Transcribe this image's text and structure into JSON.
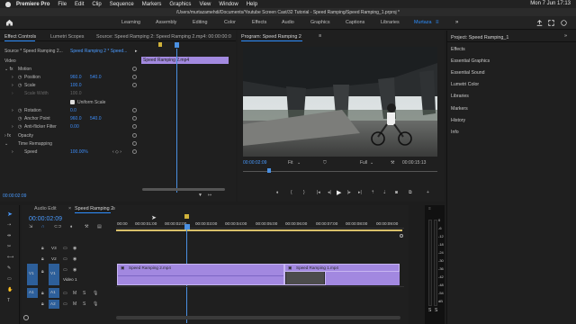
{
  "mac_menu": {
    "app": "Premiere Pro",
    "items": [
      "File",
      "Edit",
      "Clip",
      "Sequence",
      "Markers",
      "Graphics",
      "View",
      "Window",
      "Help"
    ],
    "clock": "Mon 7 Jun  17:13"
  },
  "window_title": "/Users/murtazamehdi/Documents/Youtube Screen Cast/32 Tutorial - Speed Ramping/Speed Ramping_1.prproj *",
  "workspaces": [
    "Learning",
    "Assembly",
    "Editing",
    "Color",
    "Effects",
    "Audio",
    "Graphics",
    "Captions",
    "Libraries",
    "Murtaza"
  ],
  "active_workspace": "Murtaza",
  "effect_controls": {
    "tabs": [
      "Effect Controls",
      "Lumetri Scopes",
      "Source: Speed Ramping 2: Speed Ramping 2.mp4: 00:00:00:00"
    ],
    "source": "Source * Speed Ramping 2...",
    "clip": "Speed Ramping 2 * Speed...",
    "clip_bar_label": "Speed Ramping 2.mp4",
    "video_header": "Video",
    "motion": {
      "label": "Motion",
      "position_label": "Position",
      "position_x": "960.0",
      "position_y": "540.0",
      "scale_label": "Scale",
      "scale_val": "100.0",
      "scale_width_label": "Scale Width",
      "scale_width_val": "100.0",
      "uniform_scale": "Uniform Scale",
      "rotation_label": "Rotation",
      "rotation_val": "0.0",
      "anchor_label": "Anchor Point",
      "anchor_x": "960.0",
      "anchor_y": "540.0",
      "anti_flicker_label": "Anti-flicker Filter",
      "anti_flicker_val": "0.00"
    },
    "opacity": "Opacity",
    "time_remapping": "Time Remapping",
    "speed_label": "Speed",
    "speed_val": "100.00%",
    "timecode": "00:00:02:09"
  },
  "program": {
    "title": "Program: Speed Ramping 2",
    "timecode": "00:00:02:09",
    "fit": "Fit",
    "quality": "Full",
    "duration": "00:00:15:13"
  },
  "right_panel": {
    "title": "Project: Speed Ramping_1",
    "items": [
      "Effects",
      "Essential Graphics",
      "Essential Sound",
      "Lumetri Color",
      "Libraries",
      "Markers",
      "History",
      "Info"
    ]
  },
  "timeline": {
    "tabs": [
      "Audio Edit",
      "Speed Ramping 2"
    ],
    "timecode": "00:00:02:09",
    "ruler": [
      "00:00",
      "00:00:01:00",
      "00:00:02:00",
      "00:00:03:00",
      "00:00:04:00",
      "00:00:05:00",
      "00:00:06:00",
      "00:00:07:00",
      "00:00:08:00",
      "00:00:09:00"
    ],
    "video_tracks": [
      "V3",
      "V2",
      "V1"
    ],
    "audio_tracks": [
      "A1",
      "A2"
    ],
    "track_name": "Video 1",
    "clip1": "Speed Ramping 2.mp4",
    "clip2": "Speed Ramping 1.mp4",
    "src_v": "V1",
    "src_a": "A1",
    "meter_labels": [
      "0",
      "-6",
      "-12",
      "-18",
      "-24",
      "-30",
      "-36",
      "-42",
      "-48",
      "-54",
      "dB"
    ]
  },
  "colors": {
    "accent": "#2e8fff",
    "clip": "#a288e0",
    "playhead": "#4a90e2"
  }
}
